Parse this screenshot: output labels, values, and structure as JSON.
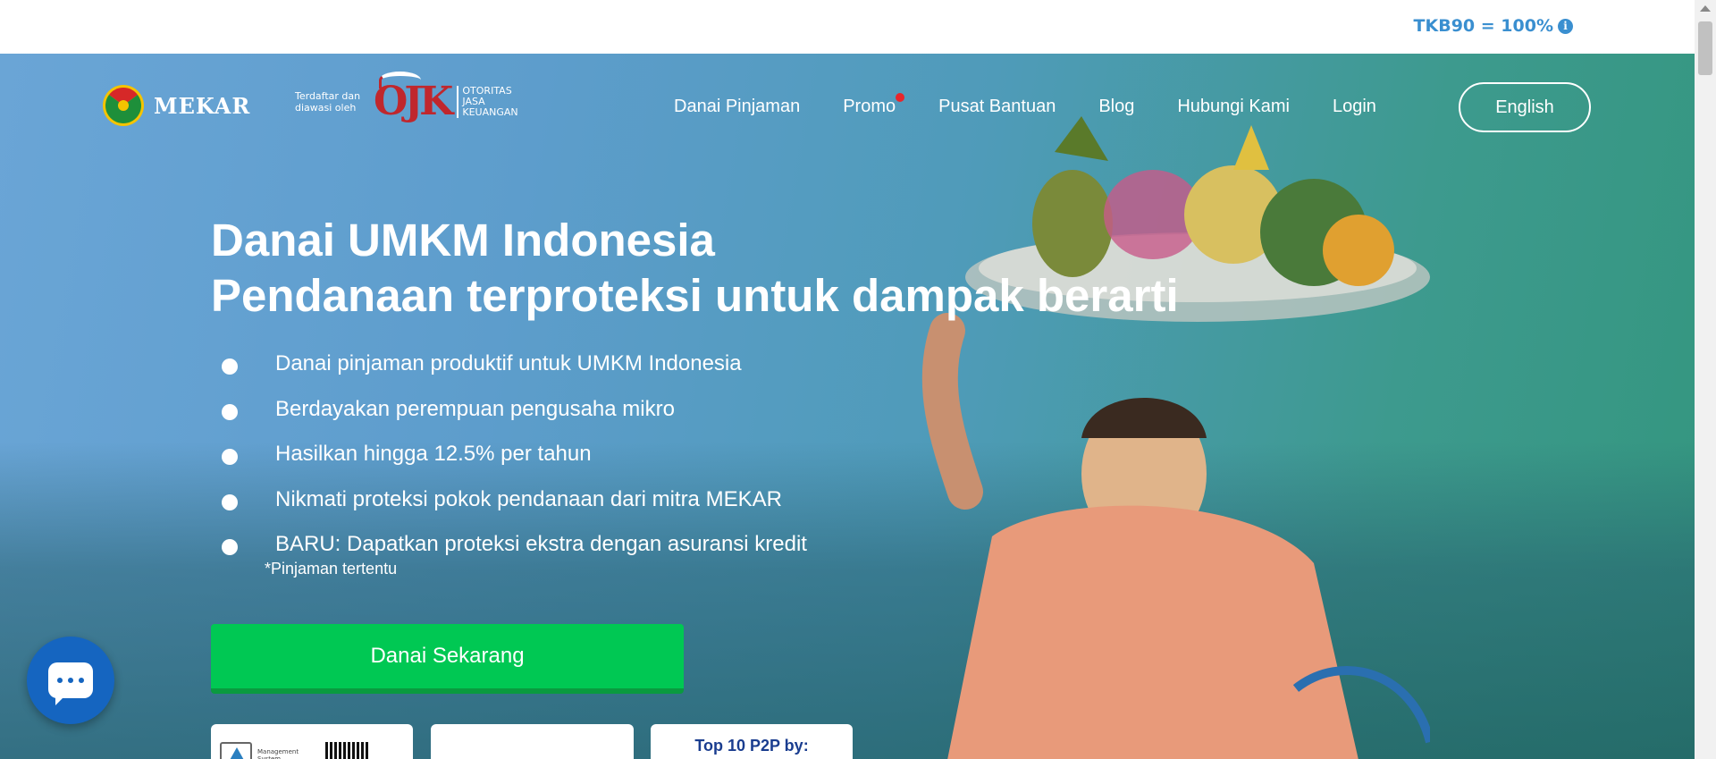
{
  "topbar": {
    "tkb_text": "TKB90 = 100%",
    "info_icon": "info-icon"
  },
  "nav": {
    "logo_text": "MEKAR",
    "ojk_registered": "Terdaftar dan diawasi oleh",
    "ojk_mark": "OJK",
    "ojk_words": [
      "OTORITAS",
      "JASA",
      "KEUANGAN"
    ],
    "items": [
      {
        "label": "Danai Pinjaman"
      },
      {
        "label": "Promo",
        "has_dot": true
      },
      {
        "label": "Pusat Bantuan"
      },
      {
        "label": "Blog"
      },
      {
        "label": "Hubungi Kami"
      },
      {
        "label": "Login"
      }
    ],
    "language_button": "English"
  },
  "hero": {
    "headline_line1": "Danai UMKM Indonesia",
    "headline_line2": "Pendanaan terproteksi untuk dampak berarti",
    "bullets": [
      "Danai pinjaman produktif untuk UMKM Indonesia",
      "Berdayakan perempuan pengusaha mikro",
      "Hasilkan hingga 12.5% per tahun",
      "Nikmati proteksi pokok pendanaan dari mitra MEKAR",
      "BARU: Dapatkan proteksi ekstra dengan asuransi kredit"
    ],
    "footnote": "*Pinjaman tertentu",
    "cta_label": "Danai Sekarang"
  },
  "cards": {
    "cert_text": "Management System",
    "top10_text": "Top 10 P2P by:"
  },
  "colors": {
    "accent": "#3a8fd0",
    "cta": "#00c853",
    "promo_dot": "#e8262c",
    "chat": "#1565c0"
  }
}
